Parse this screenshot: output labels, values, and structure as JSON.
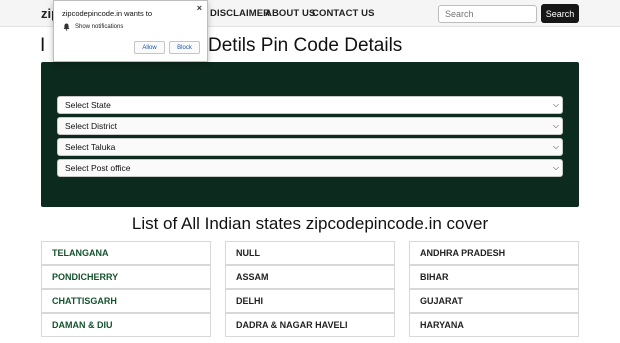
{
  "navbar": {
    "brand": "zip",
    "links": [
      "DISCLAIMER",
      "ABOUT US",
      "CONTACT US"
    ],
    "search_placeholder": "Search",
    "search_button": "Search"
  },
  "page_title": "Detils Pin Code Details",
  "page_title_visible_prefix": "I",
  "selects": [
    "Select State",
    "Select District",
    "Select Taluka",
    "Select Post office"
  ],
  "states_heading": "List of All Indian states zipcodepincode.in cover",
  "states": [
    [
      "TELANGANA",
      "NULL",
      "ANDHRA PRADESH"
    ],
    [
      "PONDICHERRY",
      "ASSAM",
      "BIHAR"
    ],
    [
      "CHATTISGARH",
      "DELHI",
      "GUJARAT"
    ],
    [
      "DAMAN & DIU",
      "DADRA & NAGAR HAVELI",
      "HARYANA"
    ]
  ],
  "notification": {
    "title": "zipcodepincode.in wants to",
    "label": "Show notifications",
    "allow": "Allow",
    "block": "Block",
    "close": "×"
  },
  "colors": {
    "panel": "#0d2a1e",
    "state_text": "#14532d",
    "search_button": "#161616"
  }
}
